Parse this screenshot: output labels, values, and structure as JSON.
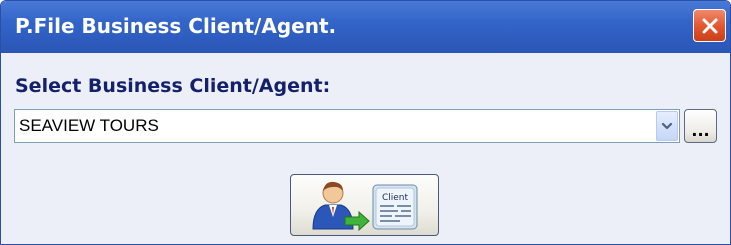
{
  "window": {
    "title": "P.File Business Client/Agent.",
    "close_icon": "close-icon"
  },
  "form": {
    "select_label": "Select Business Client/Agent:",
    "combo_value": "SEAVIEW TOURS",
    "dropdown_icon": "chevron-down-icon",
    "browse_label": "..."
  },
  "client_button": {
    "icon": "client-agent-icon",
    "icon_text": "Client"
  },
  "colors": {
    "titlebar": "#3365c9",
    "body_bg": "#ECEFF7",
    "label_text": "#15206b",
    "close_red": "#e2542c"
  }
}
